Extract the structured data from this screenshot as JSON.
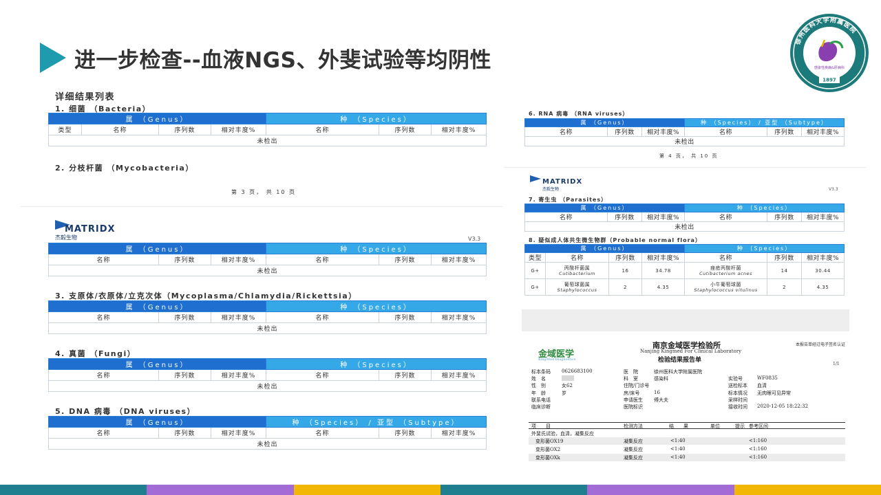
{
  "slide": {
    "title": "进一步检查--血液NGS、外斐试验等均阴性"
  },
  "seal": {
    "text_cn": "徐州医科大学附属医院",
    "dept_cn": "感染性疾病&肝病科",
    "year": "1897"
  },
  "left_report": {
    "header": "详细结果列表",
    "sec1": "1. 细菌 （Bacteria）",
    "sec2": "2. 分枝杆菌 （Mycobacteria）",
    "page": "第 3 页， 共 10 页",
    "sec3": "3. 支原体/衣原体/立克次体（Mycoplasma/Chlamydia/Rickettsia）",
    "sec4": "4. 真菌 （Fungi）",
    "sec5": "5. DNA 病毒 （DNA viruses）",
    "version": "V3.3"
  },
  "right_report": {
    "sec6": "6. RNA 病毒 （RNA viruses）",
    "page": "第 4 页， 共 10 页",
    "version": "V3.3",
    "sec7": "7. 寄生虫 （Parasites）",
    "sec8": "8. 疑似成人体共生微生物群（Probable normal flora）"
  },
  "matridx": {
    "name": "MATRIDX",
    "sub": "杰毅生物"
  },
  "table_labels": {
    "genus": "属 （Genus）",
    "species": "种 （Species）",
    "species_subtype": "种 （Species） / 亚型 （Subtype）",
    "type": "类型",
    "name": "名称",
    "reads": "序列数",
    "abundance": "相对丰度%",
    "not_detected": "未检出"
  },
  "flora_rows": [
    {
      "type": "G+",
      "genus_cn": "丙酸杆菌属",
      "genus_latin": "Cutibacterium",
      "genus_reads": "16",
      "genus_abund": "34.78",
      "species_cn": "痤疮丙酸杆菌",
      "species_latin": "Cutibacterium acnes",
      "species_reads": "14",
      "species_abund": "30.44"
    },
    {
      "type": "G+",
      "genus_cn": "葡萄球菌属",
      "genus_latin": "Staphylococcus",
      "genus_reads": "2",
      "genus_abund": "4.35",
      "species_cn": "小牛葡萄球菌",
      "species_latin": "Staphylococcus vitulinus",
      "species_reads": "2",
      "species_abund": "4.35"
    }
  ],
  "clinical": {
    "logo": "金域医学",
    "logo_sub": "KingMed Diagnostics",
    "lab_name": "南京金域医学检验所",
    "lab_en": "Nanjing Kingmed For Clinical Laboratory",
    "report_title": "检验结果报告单",
    "notice": "本报告单经过电子签名认证",
    "page": "1/1",
    "fields": {
      "barcode_label": "标本条码",
      "barcode": "0626683100",
      "hospital_label": "医　院",
      "hospital": "徐州医科大学附属医院",
      "name_label": "姓　名",
      "dept_label": "科　室",
      "dept": "感染科",
      "lab_no_label": "实验号",
      "lab_no": "WF0835",
      "sex_label": "性　别",
      "sex": "女62",
      "clinic_label": "住院/门诊号",
      "specimen_label": "送检标本",
      "specimen": "血清",
      "age_label": "年　龄",
      "age": "岁",
      "bed_label": "房/床号",
      "bed": "16",
      "cond_label": "标本情况",
      "cond": "无肉眼可见异常",
      "phone_label": "联系电话",
      "doctor_label": "申请医生",
      "doctor": "傅大夫",
      "collect_label": "采样时间",
      "diag_label": "临床诊断",
      "mark_label": "医院标识",
      "recv_label": "接收时间",
      "recv": "2020-12-05 18:22:32"
    },
    "columns": {
      "item": "项　　目",
      "method": "检测方法",
      "result": "结　　果",
      "unit": "单位",
      "hint": "提示",
      "ref": "参考区间"
    },
    "group": "外斐氏试验，血清，凝集反应",
    "results": [
      {
        "item": "变形菌OX19",
        "method": "凝集反应",
        "result": "<1:40",
        "ref": "<1:160"
      },
      {
        "item": "变形菌OX2",
        "method": "凝集反应",
        "result": "<1:40",
        "ref": "<1:160"
      },
      {
        "item": "变形菌OXk",
        "method": "凝集反应",
        "result": "<1:40",
        "ref": "<1:160"
      }
    ]
  },
  "colors": {
    "accent": "#1f9bb0",
    "genus_header": "#1e6fd0",
    "species_header": "#35a8e8",
    "bar": [
      "#1f7f8e",
      "#a26bd6",
      "#f2b705",
      "#1f7f8e",
      "#a26bd6",
      "#f2b705"
    ]
  }
}
